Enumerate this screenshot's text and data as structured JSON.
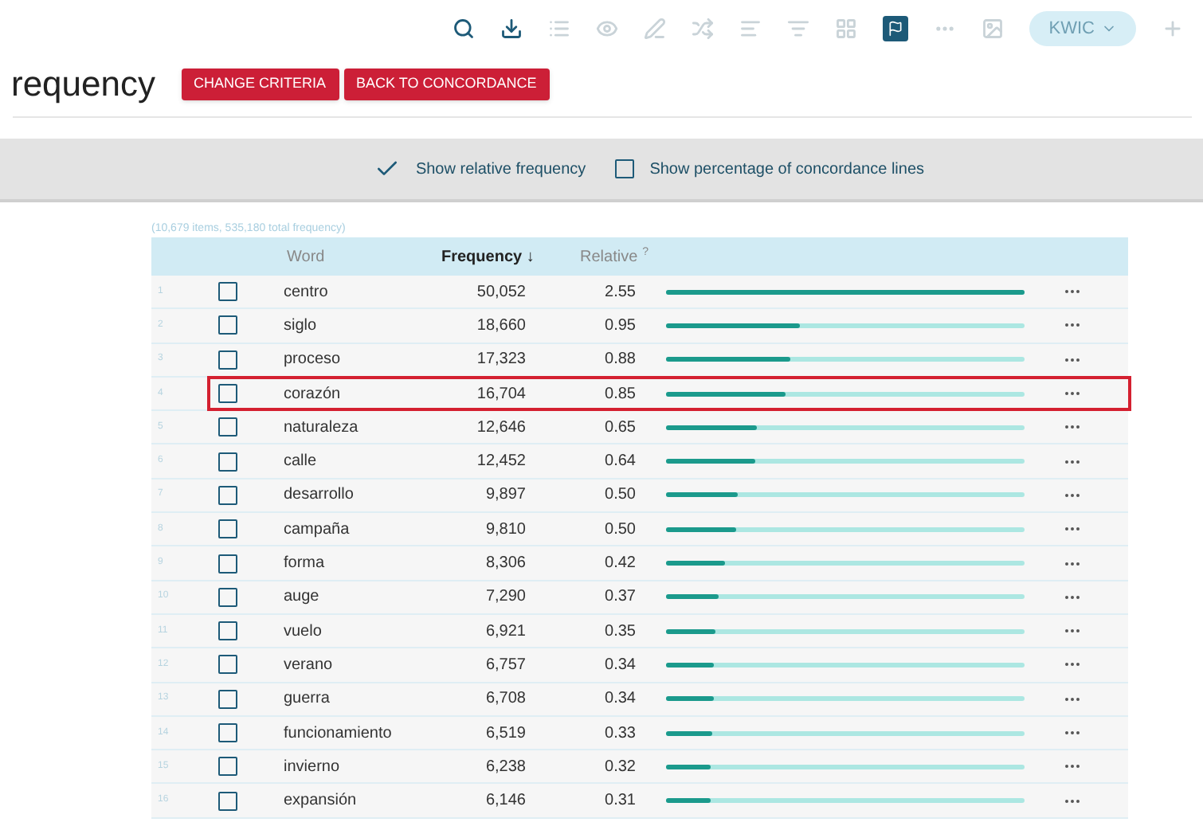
{
  "toolbar": [
    {
      "kind": "search",
      "disabled": false
    },
    {
      "kind": "download",
      "disabled": false
    },
    {
      "kind": "list",
      "disabled": true
    },
    {
      "kind": "eye",
      "disabled": true
    },
    {
      "kind": "pen",
      "disabled": true
    },
    {
      "kind": "shuffle",
      "disabled": true
    },
    {
      "kind": "sort",
      "disabled": true
    },
    {
      "kind": "filter",
      "disabled": true
    },
    {
      "kind": "grid",
      "disabled": true
    },
    {
      "kind": "flag",
      "disabled": false,
      "selected": true
    },
    {
      "kind": "more",
      "disabled": true
    },
    {
      "kind": "image",
      "disabled": true
    },
    {
      "kind": "dropdown",
      "label": "KWIC",
      "disabled": true
    },
    {
      "kind": "plus",
      "disabled": true
    }
  ],
  "title": "requency",
  "buttons": [
    "CHANGE CRITERIA",
    "BACK TO CONCORDANCE"
  ],
  "options": [
    {
      "label": "Show relative frequency",
      "checked": true
    },
    {
      "label": "Show percentage of concordance lines",
      "checked": false
    }
  ],
  "summary": "(10,679 items, 535,180 total frequency)",
  "table": {
    "columns": [
      {
        "label": "Word",
        "sorted": false
      },
      {
        "label": "Frequency ↓",
        "sorted": true
      },
      {
        "label": "Relative",
        "sup": "?",
        "sorted": false
      }
    ],
    "rows": [
      {
        "index": "1",
        "checked": false,
        "word": "centro",
        "frequency": "50,052",
        "relative": "2.55",
        "level": 1,
        "highlighted": false
      },
      {
        "index": "2",
        "checked": false,
        "word": "siglo",
        "frequency": "18,660",
        "relative": "0.95",
        "level": 0.373,
        "highlighted": false
      },
      {
        "index": "3",
        "checked": false,
        "word": "proceso",
        "frequency": "17,323",
        "relative": "0.88",
        "level": 0.346,
        "highlighted": false
      },
      {
        "index": "4",
        "checked": false,
        "word": "corazón",
        "frequency": "16,704",
        "relative": "0.85",
        "level": 0.334,
        "highlighted": true
      },
      {
        "index": "5",
        "checked": false,
        "word": "naturaleza",
        "frequency": "12,646",
        "relative": "0.65",
        "level": 0.253,
        "highlighted": false
      },
      {
        "index": "6",
        "checked": false,
        "word": "calle",
        "frequency": "12,452",
        "relative": "0.64",
        "level": 0.249,
        "highlighted": false
      },
      {
        "index": "7",
        "checked": false,
        "word": "desarrollo",
        "frequency": "9,897",
        "relative": "0.50",
        "level": 0.198,
        "highlighted": false
      },
      {
        "index": "8",
        "checked": false,
        "word": "campaña",
        "frequency": "9,810",
        "relative": "0.50",
        "level": 0.196,
        "highlighted": false
      },
      {
        "index": "9",
        "checked": false,
        "word": "forma",
        "frequency": "8,306",
        "relative": "0.42",
        "level": 0.166,
        "highlighted": false
      },
      {
        "index": "10",
        "checked": false,
        "word": "auge",
        "frequency": "7,290",
        "relative": "0.37",
        "level": 0.146,
        "highlighted": false
      },
      {
        "index": "11",
        "checked": false,
        "word": "vuelo",
        "frequency": "6,921",
        "relative": "0.35",
        "level": 0.138,
        "highlighted": false
      },
      {
        "index": "12",
        "checked": false,
        "word": "verano",
        "frequency": "6,757",
        "relative": "0.34",
        "level": 0.135,
        "highlighted": false
      },
      {
        "index": "13",
        "checked": false,
        "word": "guerra",
        "frequency": "6,708",
        "relative": "0.34",
        "level": 0.134,
        "highlighted": false
      },
      {
        "index": "14",
        "checked": false,
        "word": "funcionamiento",
        "frequency": "6,519",
        "relative": "0.33",
        "level": 0.13,
        "highlighted": false
      },
      {
        "index": "15",
        "checked": false,
        "word": "invierno",
        "frequency": "6,238",
        "relative": "0.32",
        "level": 0.125,
        "highlighted": false
      },
      {
        "index": "16",
        "checked": false,
        "word": "expansión",
        "frequency": "6,146",
        "relative": "0.31",
        "level": 0.123,
        "highlighted": false
      }
    ]
  }
}
